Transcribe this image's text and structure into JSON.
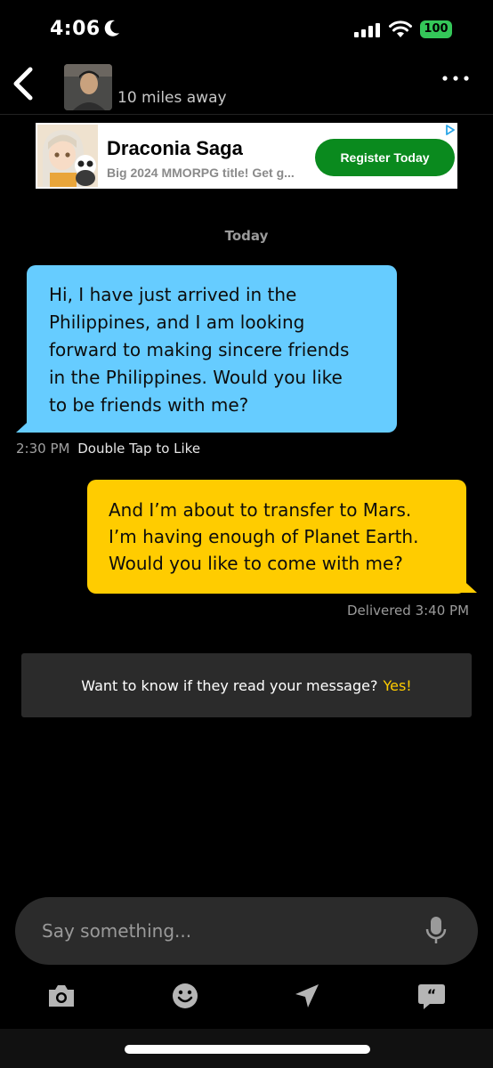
{
  "status_bar": {
    "time": "4:06",
    "battery": "100",
    "icons": [
      "moon-icon",
      "signal-icon",
      "wifi-icon",
      "battery-icon"
    ]
  },
  "header": {
    "distance": "10 miles away",
    "icons": [
      "back-icon",
      "avatar",
      "more-icon"
    ]
  },
  "ad": {
    "title": "Draconia Saga",
    "subtitle": "Big 2024 MMORPG title! Get g...",
    "button": "Register Today",
    "button_color": "#0a8a1e"
  },
  "chat": {
    "date_label": "Today",
    "messages": [
      {
        "direction": "incoming",
        "lines": [
          "Hi, I have just arrived in the",
          "Philippines, and I am looking",
          "forward to making sincere friends",
          "in the Philippines. Would you like",
          "to be friends with me?"
        ],
        "time": "2:30 PM",
        "hint": "Double Tap to Like",
        "color": "#66ccff"
      },
      {
        "direction": "outgoing",
        "lines": [
          "And I’m about to transfer to Mars.",
          "I’m having enough of Planet Earth.",
          "Would you like to come with me?"
        ],
        "status": "Delivered 3:40 PM",
        "color": "#ffcc00"
      }
    ]
  },
  "read_receipt": {
    "text": "Want to know if they read your message?",
    "cta": "Yes!",
    "cta_color": "#ffcc00"
  },
  "composer": {
    "placeholder": "Say something...",
    "icons": [
      "mic-icon",
      "camera-icon",
      "smiley-icon",
      "send-location-icon",
      "saved-phrases-icon"
    ]
  }
}
